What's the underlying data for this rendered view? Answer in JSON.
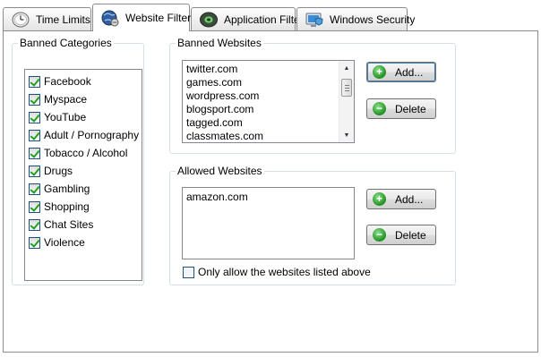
{
  "tabs": [
    {
      "label": "Time Limits",
      "icon": "clock-icon"
    },
    {
      "label": "Website Filter",
      "icon": "globe-icon",
      "active": true
    },
    {
      "label": "Application Filter",
      "icon": "application-icon"
    },
    {
      "label": "Windows Security",
      "icon": "monitor-shield-icon"
    }
  ],
  "banned_categories": {
    "title": "Banned Categories",
    "items": [
      {
        "label": "Facebook",
        "checked": true
      },
      {
        "label": "Myspace",
        "checked": true
      },
      {
        "label": "YouTube",
        "checked": true
      },
      {
        "label": "Adult / Pornography",
        "checked": true
      },
      {
        "label": "Tobacco / Alcohol",
        "checked": true
      },
      {
        "label": "Drugs",
        "checked": true
      },
      {
        "label": "Gambling",
        "checked": true
      },
      {
        "label": "Shopping",
        "checked": true
      },
      {
        "label": "Chat Sites",
        "checked": true
      },
      {
        "label": "Violence",
        "checked": true
      }
    ]
  },
  "banned_websites": {
    "title": "Banned Websites",
    "items": [
      "twitter.com",
      "games.com",
      "wordpress.com",
      "blogsport.com",
      "tagged.com",
      "classmates.com"
    ],
    "add_label": "Add...",
    "delete_label": "Delete"
  },
  "allowed_websites": {
    "title": "Allowed Websites",
    "items": [
      "amazon.com"
    ],
    "add_label": "Add...",
    "delete_label": "Delete",
    "only_allow_label": "Only allow the websites listed above",
    "only_allow_checked": false
  },
  "colors": {
    "accent_green": "#1f8f1f",
    "delete_green": "#2e9e2e",
    "tab_border": "#8c8c8c"
  }
}
